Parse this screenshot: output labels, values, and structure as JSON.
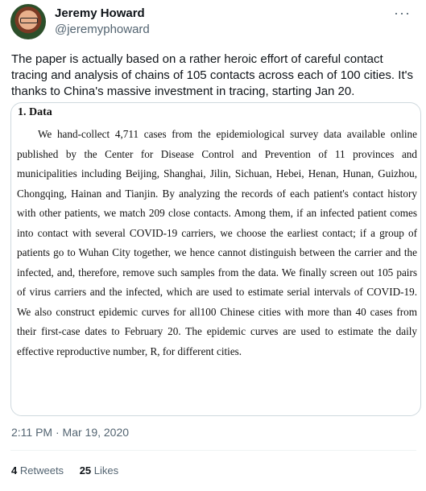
{
  "author": {
    "name": "Jeremy Howard",
    "handle": "@jeremyphoward",
    "avatar_icon": "profile-photo"
  },
  "more_icon": "more-horizontal-icon",
  "tweet_text": "The paper is actually based on a rather heroic effort of careful contact tracing and analysis of chains of 105 contacts across each of 100 cities. It's thanks to China's massive investment in tracing, starting Jan 20.",
  "attached_image": {
    "heading": "1. Data",
    "body": "We hand-collect 4,711 cases from the epidemiological survey data available online published by the Center for Disease Control and Prevention of 11 provinces and municipalities including Beijing, Shanghai, Jilin, Sichuan, Hebei, Henan, Hunan, Guizhou, Chongqing, Hainan and Tianjin. By analyzing the records of each patient's contact history with other patients, we match 209 close contacts. Among them, if an infected patient comes into contact with several COVID-19 carriers, we choose the earliest contact; if a group of patients go to Wuhan City together, we hence cannot distinguish between the carrier and the infected, and, therefore, remove such samples from the data. We finally screen out 105 pairs of virus carriers and the infected, which are used to estimate serial intervals of COVID-19. We also construct epidemic curves for all100 Chinese cities with more than 40 cases from their first-case dates to February 20. The epidemic curves are used to estimate the daily effective reproductive number, R, for different cities."
  },
  "timestamp": "2:11 PM · Mar 19, 2020",
  "stats": {
    "retweets_count": "4",
    "retweets_label": "Retweets",
    "likes_count": "25",
    "likes_label": "Likes"
  },
  "colors": {
    "text": "#0f1419",
    "secondary": "#536471",
    "border": "#cfd9de"
  }
}
